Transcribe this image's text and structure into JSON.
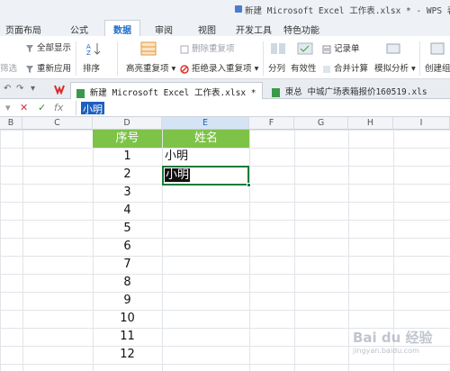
{
  "window": {
    "title": "新建 Microsoft Excel 工作表.xlsx * - WPS 表格"
  },
  "ribbon_tabs": [
    "页面布局",
    "公式",
    "数据",
    "审阅",
    "视图",
    "开发工具",
    "特色功能"
  ],
  "ribbon": {
    "show_all": "全部显示",
    "filter_partial": "筛选",
    "reapply": "重新应用",
    "sort": "排序",
    "highlight_dup": "高亮重复项",
    "delete_dup": "删除重复项",
    "reject_dup": "拒绝录入重复项",
    "split": "分列",
    "validity": "有效性",
    "record": "记录单",
    "merge_calc": "合并计算",
    "simulate": "模拟分析",
    "create_group": "创建组"
  },
  "doc_tabs": {
    "active": "新建 Microsoft Excel 工作表.xlsx *",
    "inactive": "東总 中城广场表箱报价160519.xls"
  },
  "formula_bar": {
    "fx": "fx",
    "content": "小明"
  },
  "columns": [
    "B",
    "C",
    "D",
    "E",
    "F",
    "G",
    "H",
    "I"
  ],
  "table": {
    "headers": {
      "seq": "序号",
      "name": "姓名"
    },
    "numbers": [
      "1",
      "2",
      "3",
      "4",
      "5",
      "6",
      "7",
      "8",
      "9",
      "10",
      "11",
      "12"
    ],
    "names": [
      "小明",
      "小明"
    ]
  },
  "watermark": {
    "main": "Bai du 经验",
    "sub": "jingyan.baidu.com"
  },
  "colors": {
    "header_green": "#7dc348",
    "selection_blue": "#1f5fbf",
    "active_border": "#1d7a3a"
  }
}
